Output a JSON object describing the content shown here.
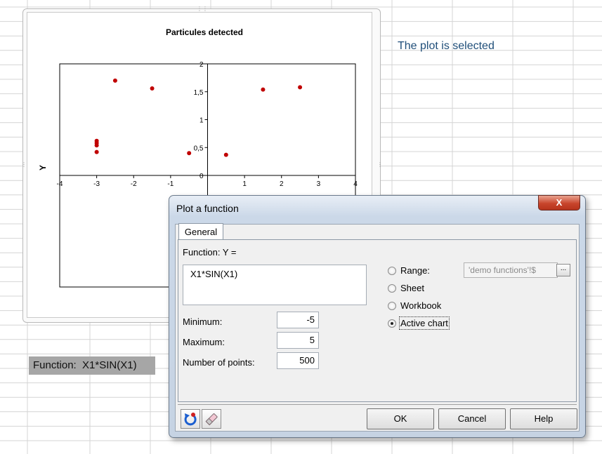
{
  "sheet": {
    "callout_text": "The plot is selected",
    "function_cell": "Function:  X1*SIN(X1)"
  },
  "chart_data": {
    "type": "scatter",
    "title": "Particules detected",
    "xlabel": "",
    "ylabel": "Y",
    "xlim": [
      -4,
      4
    ],
    "ylim": [
      -2,
      2
    ],
    "xticks": [
      "-4",
      "-3",
      "-2",
      "-1",
      "0",
      "1",
      "2",
      "3",
      "4"
    ],
    "yticks": [
      "0",
      "0,5",
      "1",
      "1,5",
      "2"
    ],
    "series": [
      {
        "color": "#c00000",
        "x": [
          -3,
          -3,
          -3,
          -3,
          -2.5,
          -1.5,
          -0.5,
          0.5,
          1.5,
          2.5
        ],
        "y": [
          0.62,
          0.58,
          0.54,
          0.42,
          1.7,
          1.56,
          0.4,
          0.37,
          1.54,
          1.58
        ]
      }
    ]
  },
  "dialog": {
    "title": "Plot a function",
    "close_glyph": "X",
    "tab_general": "General",
    "function_label": "Function: Y =",
    "function_value": "X1*SIN(X1)",
    "minimum_label": "Minimum:",
    "minimum_value": "-5",
    "maximum_label": "Maximum:",
    "maximum_value": "5",
    "points_label": "Number of points:",
    "points_value": "500",
    "range_label": "Range:",
    "range_value": "'demo functions'!$",
    "range_button": "...",
    "sheet_label": "Sheet",
    "workbook_label": "Workbook",
    "active_chart_label": "Active chart",
    "selected_option": "active_chart",
    "ok_label": "OK",
    "cancel_label": "Cancel",
    "help_label": "Help"
  },
  "icons": {
    "reset": "reset-icon",
    "eraser": "eraser-icon"
  }
}
